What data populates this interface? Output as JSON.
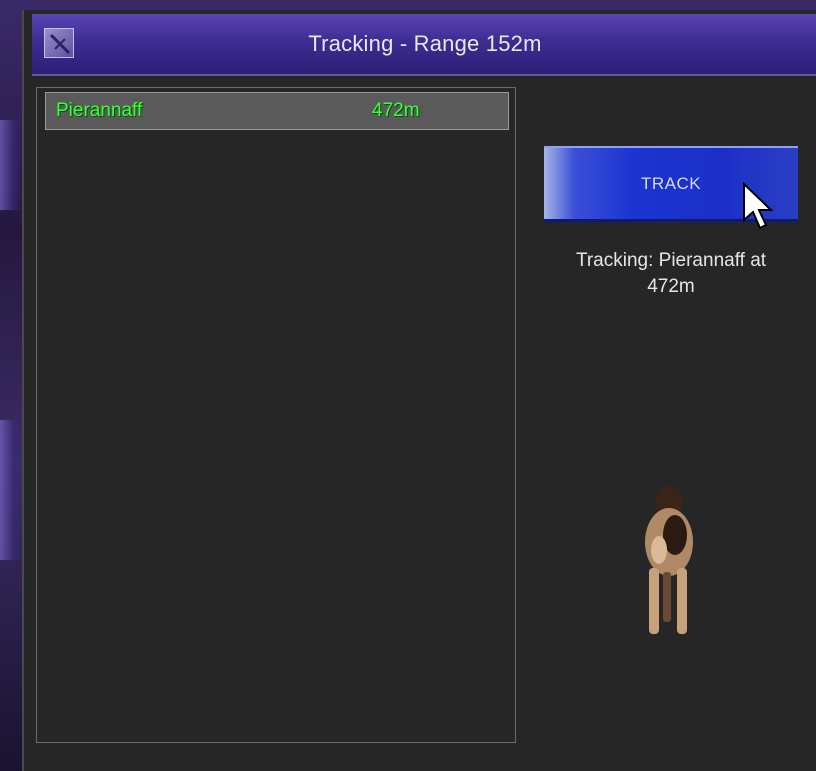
{
  "window": {
    "title": "Tracking - Range 152m"
  },
  "list": {
    "rows": [
      {
        "name": "Pierannaff",
        "distance": "472m"
      }
    ]
  },
  "track_button": {
    "label": "TRACK"
  },
  "status": {
    "line1": "Tracking: Pierannaff at",
    "line2": "472m"
  },
  "colors": {
    "title_bar": "#3e2c92",
    "button_blue": "#1d34d2",
    "list_text_green": "#3bff3b",
    "panel_bg": "#262626"
  },
  "icons": {
    "title_icon": "close-icon",
    "cursor": "cursor-icon",
    "creature": "animal-figure"
  }
}
